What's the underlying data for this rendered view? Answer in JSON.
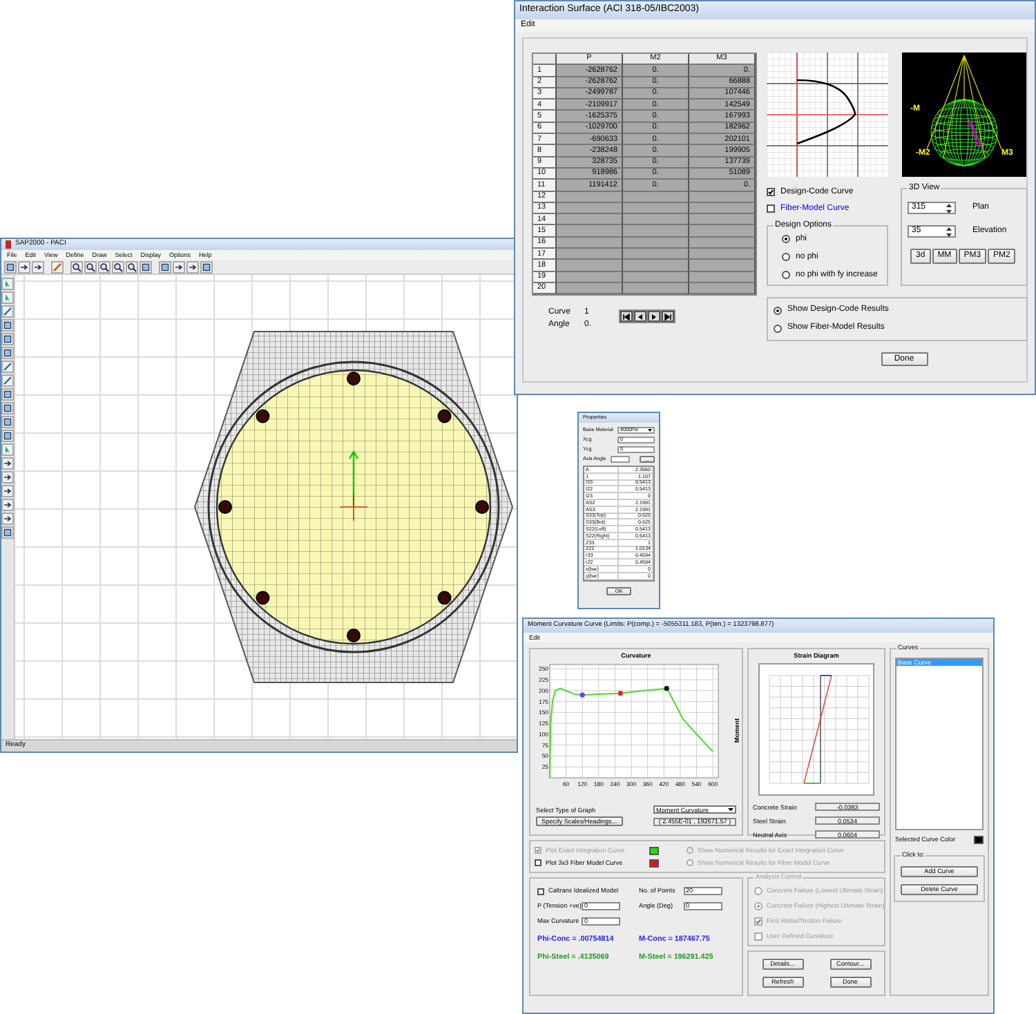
{
  "main_window": {
    "title": "SAP2000 - PACI",
    "menu": [
      "File",
      "Edit",
      "View",
      "Define",
      "Draw",
      "Select",
      "Display",
      "Options",
      "Help"
    ],
    "status": "Ready"
  },
  "interaction_window": {
    "title": "Interaction Surface   (ACI 318-05/IBC2003)",
    "menu": [
      "Edit"
    ],
    "table": {
      "columns": [
        "P",
        "M2",
        "M3"
      ],
      "rows": [
        {
          "index": "1",
          "cells": [
            "-2628762",
            "0.",
            "0."
          ]
        },
        {
          "index": "2",
          "cells": [
            "-2628762",
            "0.",
            "66888"
          ]
        },
        {
          "index": "3",
          "cells": [
            "-2499787",
            "0.",
            "107446"
          ]
        },
        {
          "index": "4",
          "cells": [
            "-2109917",
            "0.",
            "142549"
          ]
        },
        {
          "index": "5",
          "cells": [
            "-1625375",
            "0.",
            "167993"
          ]
        },
        {
          "index": "6",
          "cells": [
            "-1029700",
            "0.",
            "182962"
          ]
        },
        {
          "index": "7",
          "cells": [
            "-690633",
            "0.",
            "202101"
          ]
        },
        {
          "index": "8",
          "cells": [
            "-238248",
            "0.",
            "199905"
          ]
        },
        {
          "index": "9",
          "cells": [
            "328735",
            "0.",
            "137739"
          ]
        },
        {
          "index": "10",
          "cells": [
            "918986",
            "0.",
            "51089"
          ]
        },
        {
          "index": "11",
          "cells": [
            "1191412",
            "0.",
            "0."
          ]
        },
        {
          "index": "12"
        },
        {
          "index": "13"
        },
        {
          "index": "14"
        },
        {
          "index": "15"
        },
        {
          "index": "16"
        },
        {
          "index": "17"
        },
        {
          "index": "18"
        },
        {
          "index": "19"
        },
        {
          "index": "20"
        }
      ]
    },
    "curve_info": [
      {
        "label": "Curve",
        "value": "1"
      },
      {
        "label": "Angle",
        "value": "0."
      }
    ],
    "checkboxes": [
      {
        "label": "Design-Code Curve",
        "checked": true,
        "color": "#000000"
      },
      {
        "label": "Fiber-Model Curve",
        "checked": false,
        "color": "#0000ff"
      }
    ],
    "design_options": {
      "title": "Design Options",
      "options": [
        {
          "label": "phi",
          "selected": true
        },
        {
          "label": "no phi",
          "selected": false
        },
        {
          "label": "no phi with fy increase",
          "selected": false
        }
      ]
    },
    "view_3d": {
      "title": "3D View",
      "spinners": [
        {
          "label": "Plan",
          "value": "315"
        },
        {
          "label": "Elevation",
          "value": "35"
        }
      ],
      "buttons": [
        "3d",
        "MM",
        "PM3",
        "PM2"
      ],
      "axis_labels": [
        "-M",
        "-M2",
        "M3"
      ]
    },
    "results": [
      {
        "label": "Show Design-Code Results",
        "selected": true
      },
      {
        "label": "Show Fiber-Model Results",
        "selected": false
      }
    ],
    "done": "Done"
  },
  "properties_window": {
    "title": "Properties",
    "fields": [
      {
        "label": "Base Material",
        "value": "4000Psi",
        "kind": "select"
      },
      {
        "label": "Xcg",
        "value": "0",
        "kind": "text"
      },
      {
        "label": "Ycg",
        "value": "0",
        "kind": "text"
      }
    ],
    "axis_angle": {
      "label": "Axis Angle",
      "button": "..."
    },
    "rows": [
      [
        "A",
        "2.3560"
      ],
      [
        "J",
        "1.107"
      ],
      [
        "I33",
        "0.5413"
      ],
      [
        "I22",
        "0.5413"
      ],
      [
        "I23",
        "0"
      ],
      [
        "AS2",
        "2.1991"
      ],
      [
        "AS3",
        "2.1991"
      ],
      [
        "S33(Top)",
        "0.625"
      ],
      [
        "S33(Bot)",
        "0.625"
      ],
      [
        "S22(Left)",
        "0.5413"
      ],
      [
        "S22(Right)",
        "0.5413"
      ],
      [
        "Z33",
        "1"
      ],
      [
        "Z22",
        "1.0134"
      ],
      [
        "r33",
        "0.4594"
      ],
      [
        "r22",
        "0.4594"
      ],
      [
        "x(bar)",
        "0"
      ],
      [
        "y(bar)",
        "0"
      ]
    ],
    "ok": "OK"
  },
  "moment_window": {
    "title": "Moment Curvature Curve (Limits:  P(comp.) = -5055311.183, P(ten.) = 1323798.877)",
    "menu": [
      "Edit"
    ],
    "chart_data": {
      "type": "line",
      "title": "Curvature",
      "ylabel": "Moment",
      "x": [
        0,
        3,
        10,
        20,
        40,
        60,
        90,
        120,
        180,
        260,
        350,
        430,
        440,
        490,
        540,
        600
      ],
      "series": [
        {
          "color": "#44dd22",
          "values": [
            0,
            120,
            175,
            200,
            205,
            200,
            192,
            190,
            192,
            194,
            200,
            205,
            195,
            135,
            100,
            60
          ]
        }
      ],
      "xlim": [
        0,
        620
      ],
      "ylim": [
        0,
        260
      ],
      "xticks": [
        60,
        120,
        180,
        240,
        300,
        360,
        420,
        480,
        540,
        600
      ],
      "yticks": [
        25,
        50,
        75,
        100,
        125,
        150,
        175,
        200,
        225,
        250
      ],
      "grid": true
    },
    "graph_type": {
      "label": "Select Type of Graph",
      "value": "Moment Curvature"
    },
    "specify_button": "Specify Scales/Headings...",
    "readout": "( 2.455E-01 , 192671.57 )",
    "strain": {
      "title": "Strain Diagram",
      "readings": [
        {
          "label": "Concrete Strain",
          "value": "-0.0383"
        },
        {
          "label": "Steel Strain",
          "value": "0.0534"
        },
        {
          "label": "Neutral Axis",
          "value": "0.0604"
        }
      ]
    },
    "plot_options": [
      {
        "label": "Plot Exact Integration Curve",
        "checked": true,
        "disabled": true,
        "color": "#22dd00"
      },
      {
        "label": "Plot 3x3 Fiber Model Curve",
        "checked": false,
        "disabled": false,
        "color": "#ee1111"
      }
    ],
    "numeric_options": [
      {
        "label": "Show Numerical Results for Exact Integration Curve",
        "selected": true,
        "disabled": true
      },
      {
        "label": "Show Numerical Results for Fiber Model Curve",
        "selected": false,
        "disabled": true
      }
    ],
    "caltrans": {
      "label": "Caltrans Idealized Model",
      "checked": false
    },
    "inputs": [
      {
        "label": "No. of Points",
        "value": "20"
      },
      {
        "label": "P (Tension +ve)",
        "value": "0"
      },
      {
        "label": "Angle (Deg)",
        "value": "0"
      },
      {
        "label": "Max Curvature",
        "value": "0"
      }
    ],
    "results": [
      {
        "text": "Phi-Conc = .00754814",
        "color": "#2222ee"
      },
      {
        "text": "M-Conc = 187467.75",
        "color": "#2222ee"
      },
      {
        "text": "Phi-Steel = .4135069",
        "color": "#229922"
      },
      {
        "text": "M-Steel = 196291.425",
        "color": "#229922"
      }
    ],
    "analysis_control": {
      "title": "Analysis Control",
      "items": [
        {
          "kind": "radio",
          "label": "Concrete Failure (Lowest Ultimate Strain)",
          "selected": false,
          "disabled": true
        },
        {
          "kind": "radio",
          "label": "Concrete Failure (Highest Ultimate Strain)",
          "selected": true,
          "disabled": true
        },
        {
          "kind": "checkbox",
          "label": "First Rebar/Tendon Failure",
          "selected": true,
          "disabled": true
        },
        {
          "kind": "checkbox",
          "label": "User Defined Curvature",
          "selected": false,
          "disabled": true
        }
      ]
    },
    "buttons": [
      "Details...",
      "Contour...",
      "Refresh",
      "Done"
    ],
    "curves": {
      "title": "Curves",
      "items": [
        {
          "label": "Base Curve",
          "selected": true
        }
      ],
      "color_label": "Selected Curve Color",
      "color": "#000000",
      "group_title": "Click to:",
      "buttons": [
        "Add Curve",
        "Delete Curve"
      ]
    }
  }
}
